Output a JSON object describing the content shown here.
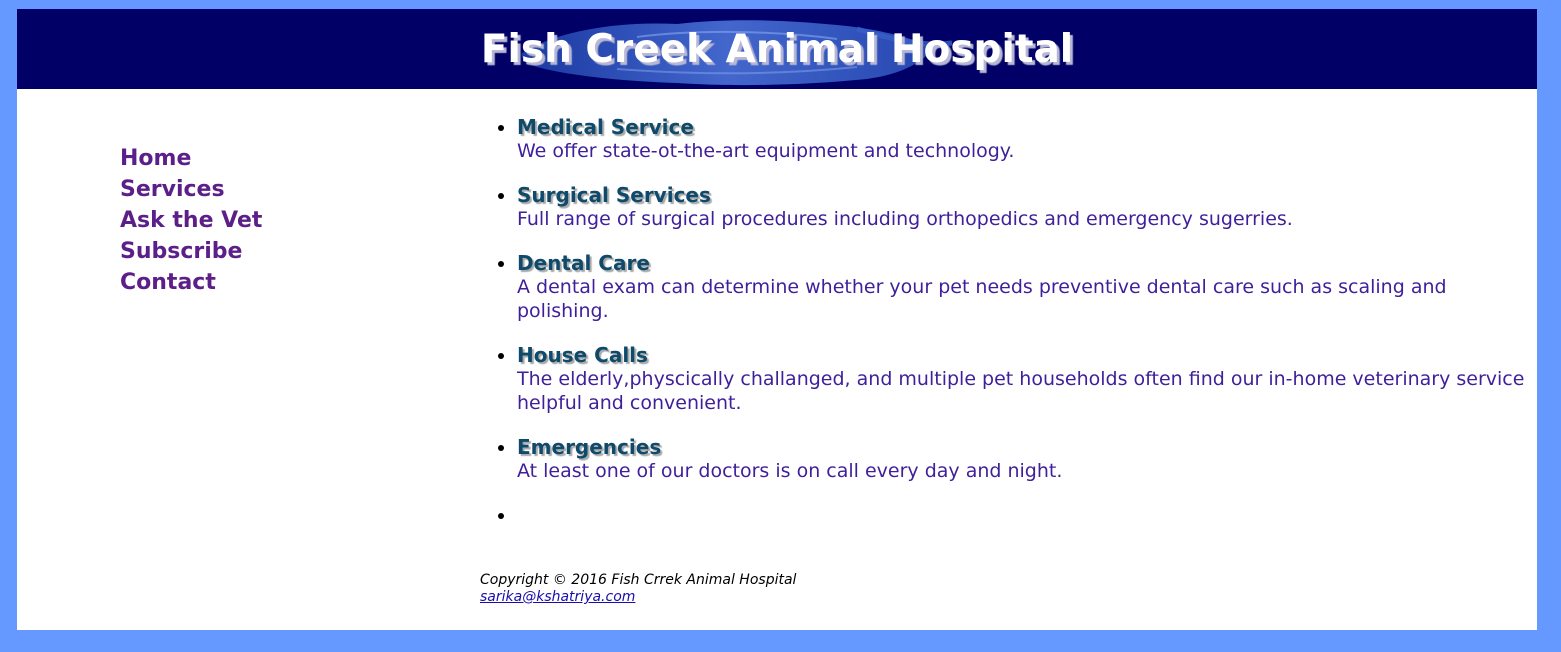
{
  "header": {
    "title": "Fish Creek Animal Hospital"
  },
  "nav": {
    "items": [
      {
        "label": "Home"
      },
      {
        "label": "Services"
      },
      {
        "label": "Ask the Vet"
      },
      {
        "label": "Subscribe"
      },
      {
        "label": "Contact"
      }
    ]
  },
  "services": [
    {
      "name": "Medical Service",
      "desc": "We offer state-ot-the-art equipment and technology."
    },
    {
      "name": "Surgical Services",
      "desc": "Full range of surgical procedures including orthopedics and emergency sugerries."
    },
    {
      "name": "Dental Care",
      "desc": "A dental exam can determine whether your pet needs preventive dental care such as scaling and polishing."
    },
    {
      "name": "House Calls",
      "desc": "The elderly,physcically challanged, and multiple pet households often find our in-home veterinary service helpful and convenient."
    },
    {
      "name": "Emergencies",
      "desc": "At least one of our doctors is on call every day and night."
    }
  ],
  "footer": {
    "copyright": "Copyright © 2016 Fish Crrek Animal Hospital",
    "email": "sarika@kshatriya.com"
  },
  "colors": {
    "page_background": "#6699ff",
    "header_background": "#000066",
    "nav_link": "#5c1f8a",
    "service_heading": "#0f4a6b",
    "service_text": "#3f1f9a"
  }
}
